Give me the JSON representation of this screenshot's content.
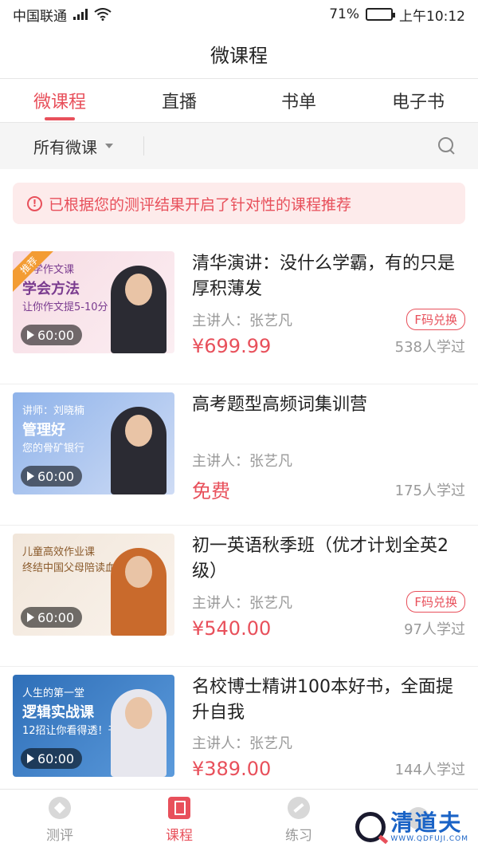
{
  "status_bar": {
    "carrier": "中国联通",
    "battery_percent": "71%",
    "battery_level": 0.71,
    "time": "上午10:12"
  },
  "header": {
    "title": "微课程"
  },
  "tabs": [
    {
      "label": "微课程",
      "active": true
    },
    {
      "label": "直播",
      "active": false
    },
    {
      "label": "书单",
      "active": false
    },
    {
      "label": "电子书",
      "active": false
    }
  ],
  "filter": {
    "label": "所有微课"
  },
  "notice": {
    "text": "已根据您的测评结果开启了针对性的课程推荐"
  },
  "courses": [
    {
      "title": "清华演讲：没什么学霸，有的只是厚积薄发",
      "lecturer": "主讲人：张艺凡",
      "badge": "F码兑换",
      "price": "¥699.99",
      "learners": "538人学过",
      "duration": "60:00",
      "ribbon": "推荐",
      "thumb_line1": "小学作文课",
      "thumb_line2": "学会方法",
      "thumb_line3": "让你作文提5-10分",
      "thumb_colors": [
        "#f7dce4",
        "#fbeef2"
      ]
    },
    {
      "title": "高考题型高频词集训营",
      "lecturer": "主讲人：张艺凡",
      "badge": "",
      "price": "免费",
      "learners": "175人学过",
      "duration": "60:00",
      "ribbon": "",
      "thumb_line1": "讲师：刘晓楠",
      "thumb_line2": "管理好",
      "thumb_line3": "您的骨矿银行",
      "thumb_colors": [
        "#8fb3ea",
        "#cfdcf5"
      ]
    },
    {
      "title": "初一英语秋季班（优才计划全英2级）",
      "lecturer": "主讲人：张艺凡",
      "badge": "F码兑换",
      "price": "¥540.00",
      "learners": "97人学过",
      "duration": "60:00",
      "ribbon": "",
      "thumb_line1": "儿童高效作业课",
      "thumb_line2": "",
      "thumb_line3": "终结中国父母陪读血泪史",
      "thumb_colors": [
        "#f1e6da",
        "#faf3ec"
      ]
    },
    {
      "title": "名校博士精讲100本好书，全面提升自我",
      "lecturer": "主讲人：张艺凡",
      "badge": "",
      "price": "¥389.00",
      "learners": "144人学过",
      "duration": "60:00",
      "ribbon": "",
      "thumb_line1": "人生的第一堂",
      "thumb_line2": "逻辑实战课",
      "thumb_line3": "12招让你看得透！干得好！",
      "thumb_colors": [
        "#2f6fb8",
        "#5c9bdc"
      ]
    }
  ],
  "bottom_nav": [
    {
      "label": "测评",
      "icon": "evaluation-icon",
      "active": false
    },
    {
      "label": "课程",
      "icon": "book-icon",
      "active": true
    },
    {
      "label": "练习",
      "icon": "pencil-icon",
      "active": false
    },
    {
      "label": "",
      "icon": "profile-icon",
      "active": false
    }
  ],
  "watermark": {
    "name": "清道夫",
    "url": "WWW.QDFUJI.COM"
  },
  "colors": {
    "accent": "#e8505b",
    "muted": "#999999"
  }
}
